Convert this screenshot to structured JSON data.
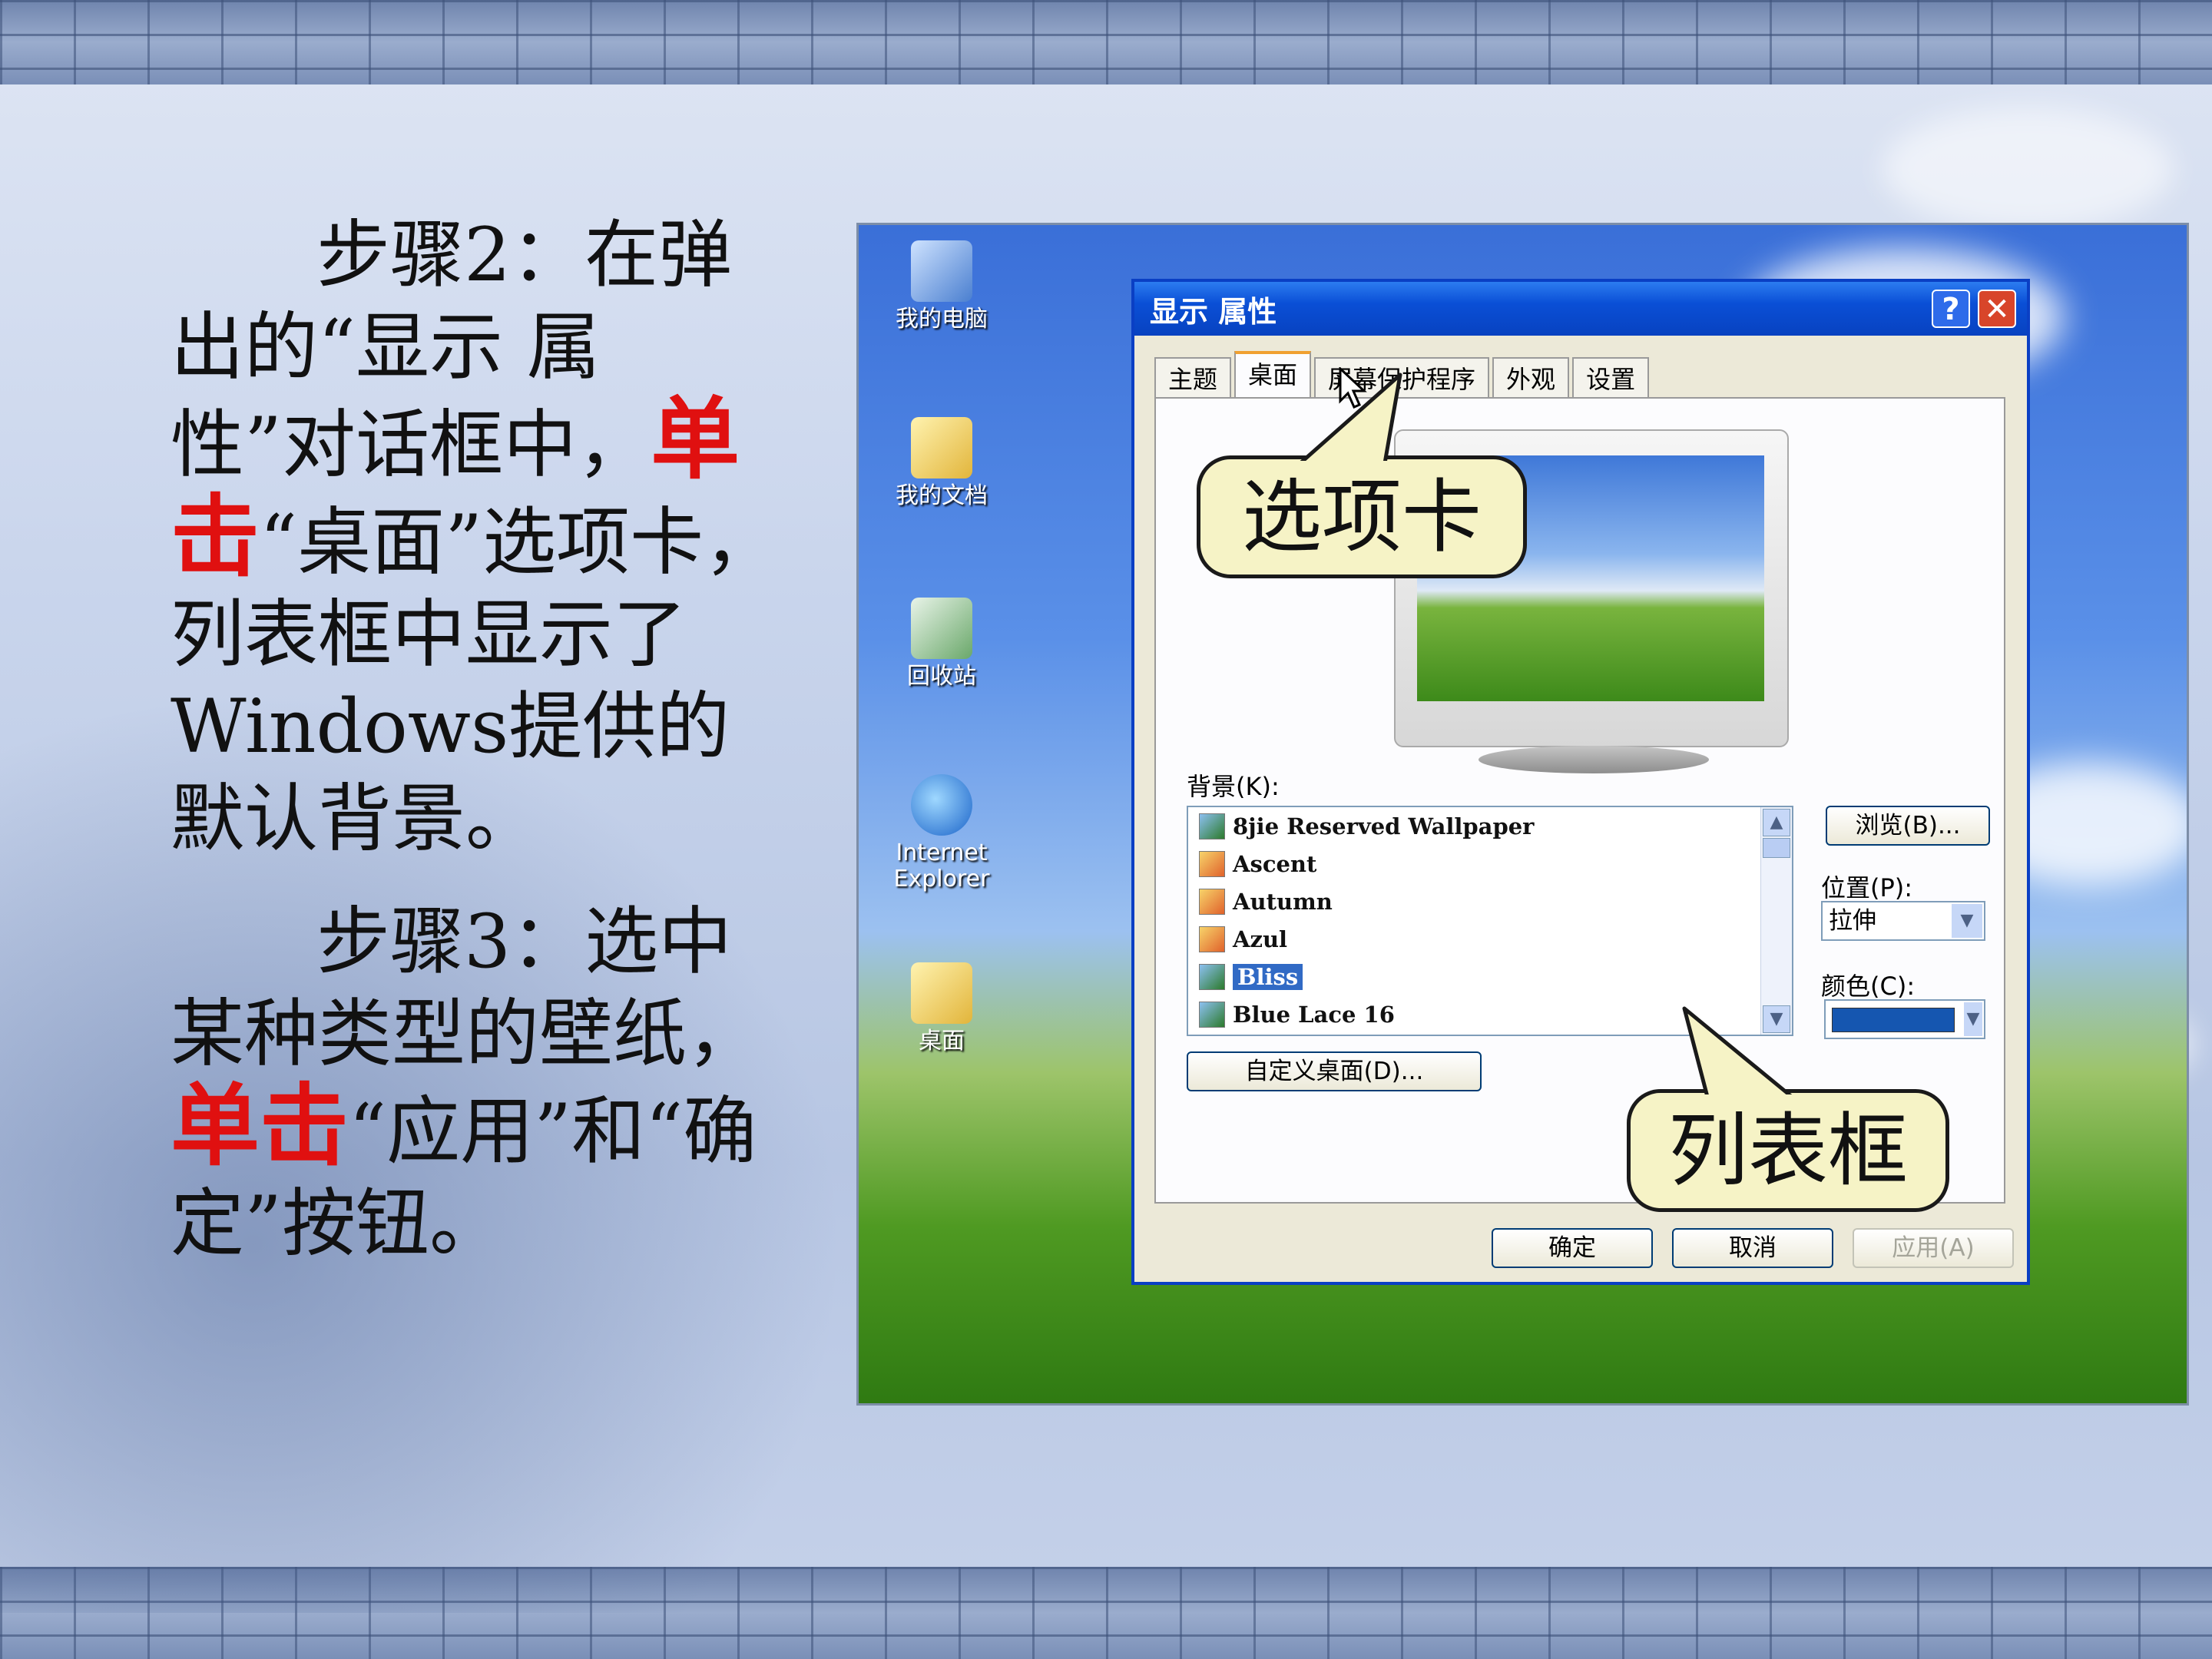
{
  "instructions": {
    "step2": {
      "prefix": "步骤2：在弹出的“显示 属性”对话框中，",
      "action": "单击",
      "suffix": "“桌面”选项卡，列表框中显示了Windows提供的默认背景。"
    },
    "step3": {
      "prefix": "步骤3：选中某种类型的壁纸，",
      "action": "单击",
      "suffix": "“应用”和“确定”按钮。"
    },
    "highlight_color": "#e01010"
  },
  "desktop_icons": [
    {
      "label": "我的电脑",
      "icon": "my-computer-icon"
    },
    {
      "label": "我的文档",
      "icon": "my-documents-folder-icon"
    },
    {
      "label": "回收站",
      "icon": "recycle-bin-icon"
    },
    {
      "label": "Internet Explorer",
      "icon": "internet-explorer-icon"
    },
    {
      "label": "桌面",
      "icon": "folder-icon"
    }
  ],
  "dialog": {
    "title": "显示 属性",
    "help_glyph": "?",
    "close_glyph": "✕",
    "tabs": [
      "主题",
      "桌面",
      "屏幕保护程序",
      "外观",
      "设置"
    ],
    "active_tab": "桌面",
    "background_label": "背景(K):",
    "background_list": [
      {
        "name": "8jie Reserved Wallpaper",
        "icon": "image-file-icon"
      },
      {
        "name": "Ascent",
        "icon": "image-file-icon"
      },
      {
        "name": "Autumn",
        "icon": "image-file-icon"
      },
      {
        "name": "Azul",
        "icon": "image-file-icon"
      },
      {
        "name": "Bliss",
        "icon": "image-file-icon",
        "selected": true
      },
      {
        "name": "Blue Lace 16",
        "icon": "image-file-icon"
      }
    ],
    "browse_button": "浏览(B)...",
    "position_label": "位置(P):",
    "position_value": "拉伸",
    "color_label": "颜色(C):",
    "color_value": "#1556b0",
    "customize_button": "自定义桌面(D)...",
    "ok_button": "确定",
    "cancel_button": "取消",
    "apply_button": "应用(A)"
  },
  "callouts": {
    "tab_callout": "选项卡",
    "list_callout": "列表框"
  }
}
